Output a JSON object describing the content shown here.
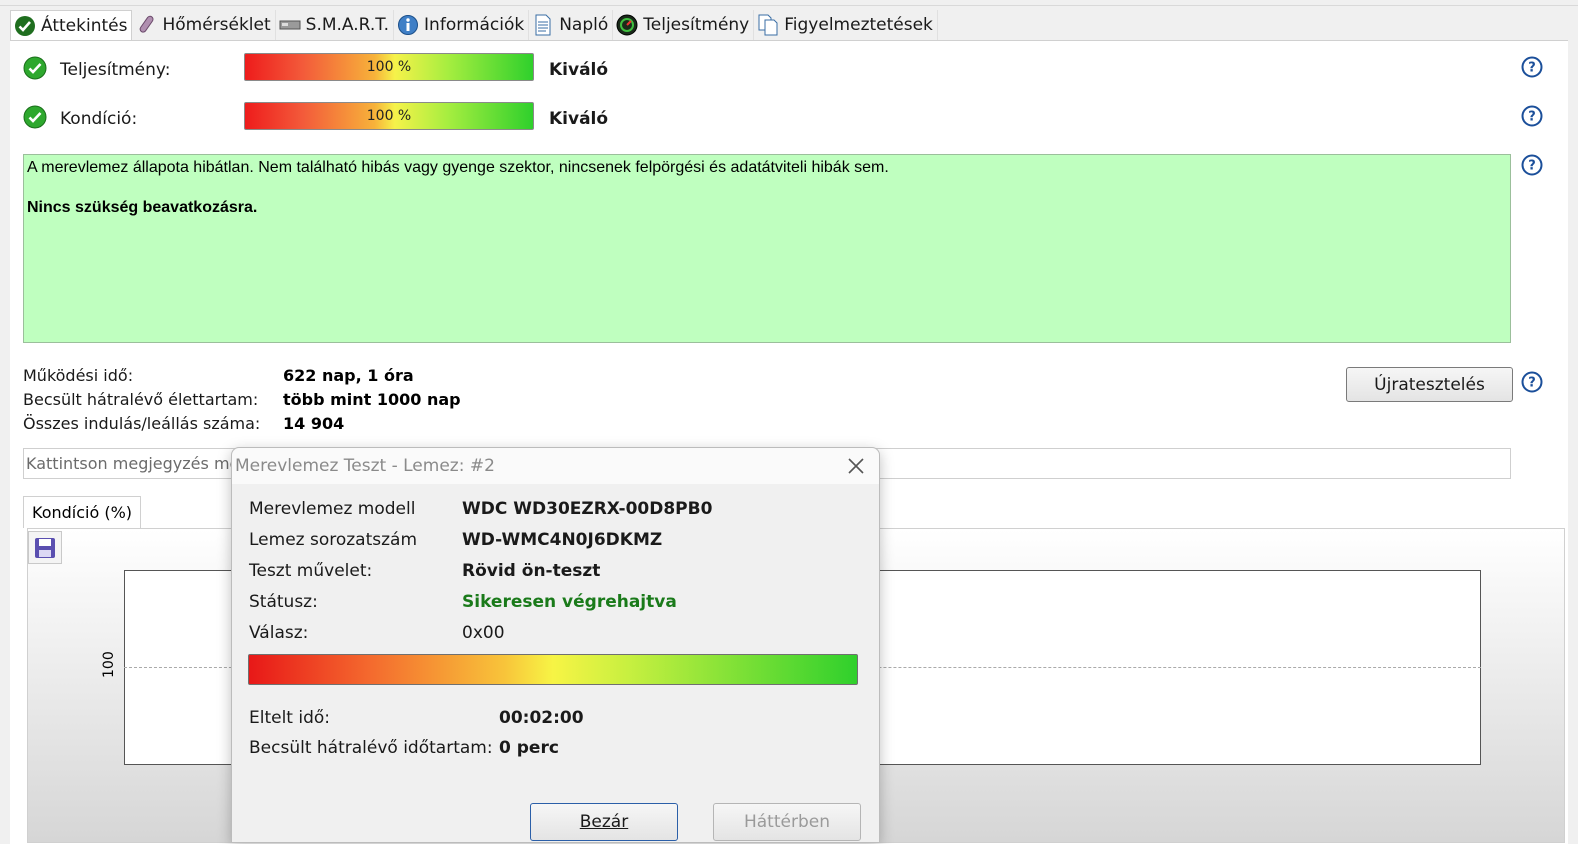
{
  "tabs": [
    {
      "label": "Áttekintés",
      "icon": "check-circle-icon",
      "active": true
    },
    {
      "label": "Hőmérséklet",
      "icon": "thermometer-icon"
    },
    {
      "label": "S.M.A.R.T.",
      "icon": "drive-icon"
    },
    {
      "label": "Információk",
      "icon": "info-icon"
    },
    {
      "label": "Napló",
      "icon": "document-icon"
    },
    {
      "label": "Teljesítmény",
      "icon": "speedometer-icon"
    },
    {
      "label": "Figyelmeztetések",
      "icon": "copy-document-icon"
    }
  ],
  "overview": {
    "performance": {
      "label": "Teljesítmény:",
      "bar_text": "100 %",
      "value_fraction": 1.0,
      "rating": "Kiváló"
    },
    "condition": {
      "label": "Kondíció:",
      "bar_text": "100 %",
      "value_fraction": 1.0,
      "rating": "Kiváló"
    },
    "summary_line1": "A merevlemez állapota hibátlan. Nem található hibás vagy gyenge szektor, nincsenek felpörgési és adatátviteli hibák sem.",
    "summary_line2": "Nincs szükség beavatkozásra.",
    "summary_bg": "#bfffbf",
    "stats": [
      {
        "label": "Működési idő:",
        "value": "622 nap, 1 óra"
      },
      {
        "label": "Becsült hátralévő élettartam:",
        "value": "több mint 1000 nap"
      },
      {
        "label": "Összes indulás/leállás száma:",
        "value": "14 904"
      }
    ],
    "retest_button": "Újratesztelés",
    "note_placeholder": "Kattintson megjegyzés me"
  },
  "chart_tab": {
    "label": "Kondíció  (%)"
  },
  "chart_data": {
    "type": "line",
    "title": "",
    "xlabel": "",
    "ylabel": "",
    "y_tick_labels": [
      "100"
    ],
    "grid": true,
    "series": []
  },
  "dialog": {
    "title": "Merevlemez Teszt - Lemez: #2",
    "rows": [
      {
        "label": "Merevlemez modell",
        "value": "WDC WD30EZRX-00D8PB0",
        "bold": true
      },
      {
        "label": "Lemez sorozatszám",
        "value": "WD-WMC4N0J6DKMZ",
        "bold": true
      },
      {
        "label": "Teszt művelet:",
        "value": "Rövid ön-teszt",
        "bold": true
      },
      {
        "label": "Státusz:",
        "value": "Sikeresen végrehajtva",
        "bold": true,
        "color": "#1a7a1a"
      },
      {
        "label": "Válasz:",
        "value": "0x00",
        "bold": false
      }
    ],
    "progress_fraction": 1.0,
    "elapsed_label": "Eltelt idő:",
    "elapsed_value": "00:02:00",
    "remaining_label": "Becsült hátralévő időtartam:",
    "remaining_value": "0 perc",
    "close_button": "Bezár",
    "background_button": "Háttérben"
  }
}
